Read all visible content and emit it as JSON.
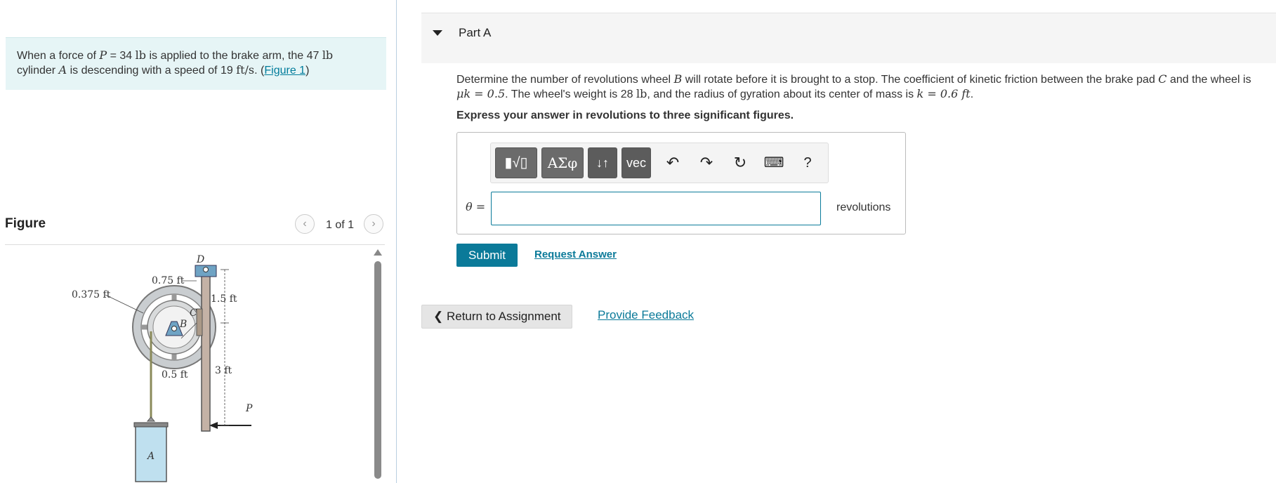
{
  "problem": {
    "text_1": "When a force of ",
    "P_sym": "P",
    "text_2": " = 34 ",
    "lb1": "lb",
    "text_3": " is applied to the brake arm, the 47 ",
    "lb2": "lb",
    "text_4": "cylinder ",
    "A_sym": "A",
    "text_5": " is descending with a speed of 19 ",
    "speed_unit": "ft/s",
    "text_6": ". (",
    "figure_link": "Figure 1",
    "text_7": ")"
  },
  "figure_panel": {
    "title": "Figure",
    "counter": "1 of 1",
    "prev_icon": "‹",
    "next_icon": "›",
    "labels": {
      "top_dim": "0.75 ft",
      "left_dim": "0.375 ft",
      "D": "D",
      "C": "C",
      "B": "B",
      "dim_15": "1.5 ft",
      "dim_05": "0.5 ft",
      "dim_3": "3 ft",
      "P": "P",
      "A": "A"
    }
  },
  "part": {
    "title": "Part A",
    "q1": "Determine the number of revolutions wheel ",
    "B": "B",
    "q2": " will rotate before it is brought to a stop. The coefficient of kinetic friction between the brake pad ",
    "C": "C",
    "q3": " and the wheel is ",
    "mu": "μk = 0.5",
    "q4": ". The wheel's weight is 28 ",
    "lb": "lb",
    "q5": ", and the radius of gyration about its center of mass is ",
    "k": "k = 0.6 ft",
    "q6": ".",
    "instruction": "Express your answer in revolutions to three significant figures."
  },
  "toolbar": {
    "template": "▮√▯",
    "greek": "ΑΣφ",
    "updown": "↓↑",
    "vec": "vec",
    "undo": "↶",
    "redo": "↷",
    "reset": "↻",
    "keyboard": "⌨",
    "help": "?"
  },
  "answer": {
    "label": "θ =",
    "value": "",
    "unit": "revolutions"
  },
  "actions": {
    "submit": "Submit",
    "request_answer": "Request Answer",
    "return": "❮ Return to Assignment",
    "feedback": "Provide Feedback"
  }
}
